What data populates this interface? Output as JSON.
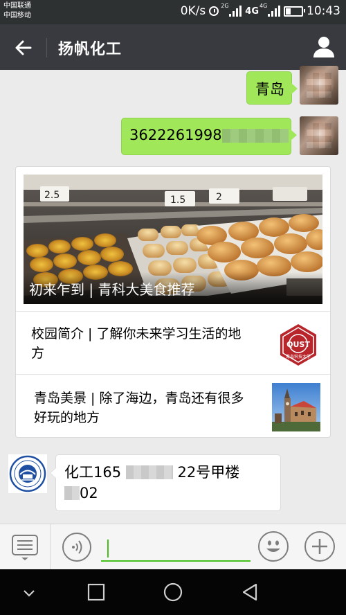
{
  "status_bar": {
    "carrier_1": "中国联通",
    "carrier_2": "中国移动",
    "net_speed": "0K/s",
    "sig1_type": "2G",
    "sig2_type": "4G",
    "net_label": "4G",
    "time": "10:43",
    "battery_level": 0.3
  },
  "header": {
    "title": "扬帆化工",
    "back_icon": "arrow-left-icon",
    "profile_icon": "person-icon"
  },
  "messages": [
    {
      "side": "right",
      "text": "青岛"
    },
    {
      "side": "right",
      "text_visible": "3622261998"
    }
  ],
  "article_card": {
    "cover_title": "初来乍到 | 青科大美食推荐",
    "price_tags": [
      "2.5",
      "1.5",
      "2"
    ],
    "items": [
      {
        "title": "校园简介 | 了解你未来学习生活的地方",
        "badge_text": "QUST",
        "badge_sub": "青岛科技大学"
      },
      {
        "title": "青岛美景 | 除了海边，青岛还有很多好玩的地方"
      }
    ]
  },
  "incoming": {
    "line1_start": "化工165",
    "line1_end": "22号甲楼",
    "line2_end": "02"
  },
  "input_bar": {
    "menu_icon": "keyboard-menu-icon",
    "voice_icon": "voice-icon",
    "emoji_icon": "emoji-icon",
    "plus_icon": "plus-icon"
  },
  "nav_bar": {
    "icons": [
      "chevron-down-icon",
      "square-icon",
      "circle-icon",
      "triangle-back-icon"
    ]
  },
  "colors": {
    "titlebar": "#393a3f",
    "bubble_green": "#a0e75a",
    "background": "#ebebeb",
    "input_underline": "#45c01a"
  }
}
